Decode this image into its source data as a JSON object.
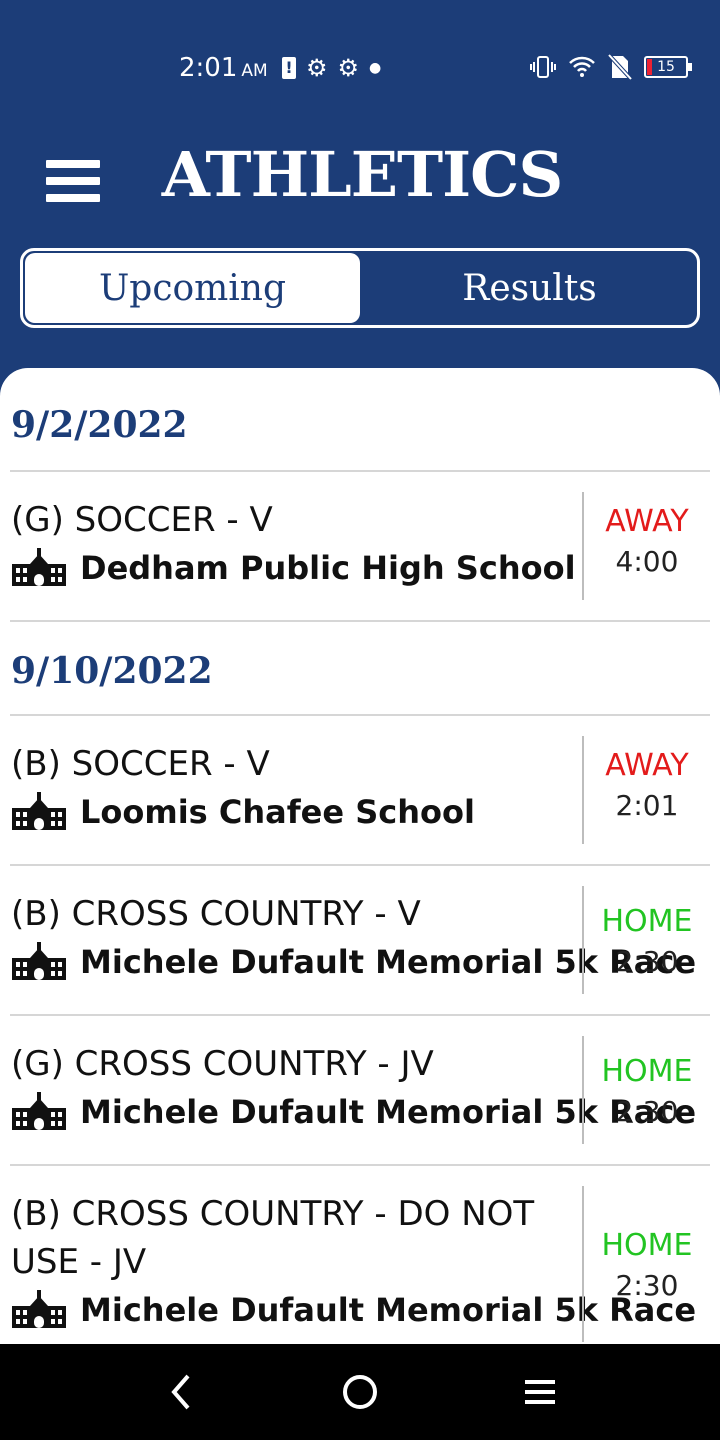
{
  "status_bar": {
    "time": "2:01",
    "ampm": "AM",
    "battery": "15"
  },
  "header": {
    "title": "ATHLETICS"
  },
  "tabs": [
    {
      "label": "Upcoming"
    },
    {
      "label": "Results"
    }
  ],
  "sections": [
    {
      "date": "9/2/2022",
      "events": [
        {
          "sport": "(G) SOCCER - V",
          "venue": "Dedham Public High School",
          "location": "AWAY",
          "time": "4:00"
        }
      ]
    },
    {
      "date": "9/10/2022",
      "events": [
        {
          "sport": "(B) SOCCER - V",
          "venue": "Loomis Chafee School",
          "location": "AWAY",
          "time": "2:01"
        },
        {
          "sport": "(B) CROSS COUNTRY - V",
          "venue": "Michele Dufault Memorial 5k Race",
          "location": "HOME",
          "time": "2:30"
        },
        {
          "sport": "(G) CROSS COUNTRY - JV",
          "venue": "Michele Dufault Memorial 5k Race",
          "location": "HOME",
          "time": "2:30"
        },
        {
          "sport": "(B) CROSS COUNTRY - DO NOT USE - JV",
          "venue": "Michele Dufault Memorial 5k Race",
          "location": "HOME",
          "time": "2:30"
        }
      ]
    }
  ],
  "colors": {
    "brand": "#1c3d78",
    "away": "#e31b1b",
    "home": "#22c422"
  }
}
